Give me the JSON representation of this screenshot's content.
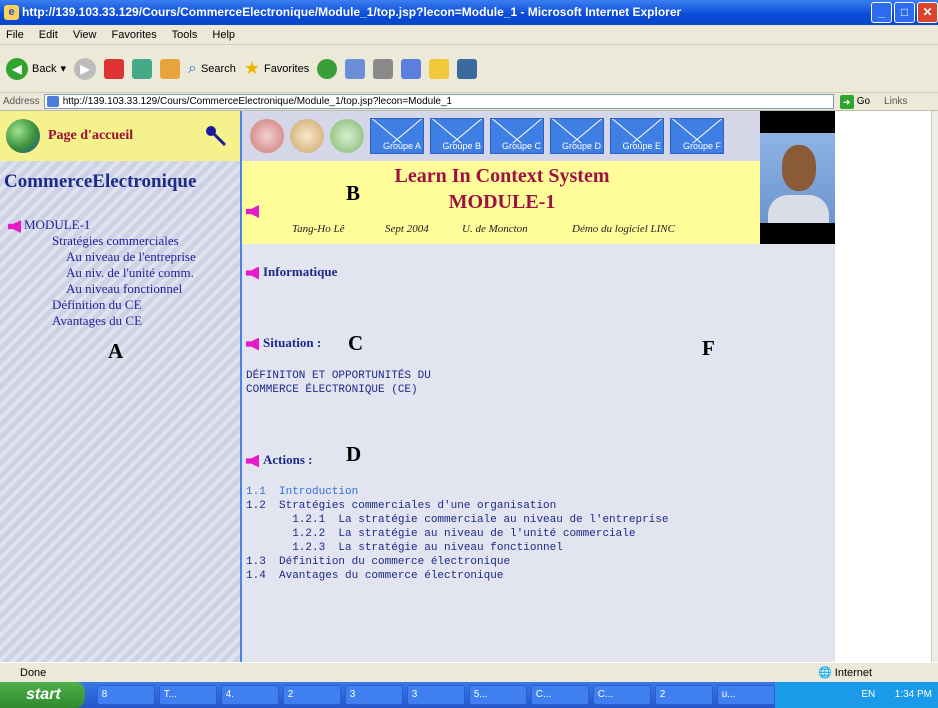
{
  "window": {
    "title": "http://139.103.33.129/Cours/CommerceElectronique/Module_1/top.jsp?lecon=Module_1 - Microsoft Internet Explorer"
  },
  "menu": [
    "File",
    "Edit",
    "View",
    "Favorites",
    "Tools",
    "Help"
  ],
  "toolbar": {
    "back": "Back",
    "search": "Search",
    "favorites": "Favorites"
  },
  "address": {
    "label": "Address",
    "url": "http://139.103.33.129/Cours/CommerceElectronique/Module_1/top.jsp?lecon=Module_1",
    "go": "Go",
    "links": "Links"
  },
  "left": {
    "home": "Page d'accueil",
    "title": "CommerceElectronique",
    "letter": "A",
    "nav": [
      "MODULE-1",
      "Stratégies commerciales",
      "Au niveau de l'entreprise",
      "Au niv. de l'unité comm.",
      "Au niveau fonctionnel",
      "Définition du CE",
      "Avantages du CE"
    ]
  },
  "groups": [
    "Groupe A",
    "Groupe B",
    "Groupe C",
    "Groupe D",
    "Groupe E",
    "Groupe F"
  ],
  "header": {
    "line1": "Learn In Context System",
    "line2": "MODULE-1",
    "letter": "B",
    "author": "Tang-Ho Lê",
    "date": "Sept 2004",
    "univ": "U. de Moncton",
    "demo": "Démo du logiciel LINC"
  },
  "content": {
    "informatique": "Informatique",
    "situation": "Situation :",
    "letterC": "C",
    "letterF": "F",
    "situation_text": "DÉFINITON ET OPPORTUNITÉS DU\nCOMMERCE ÉLECTRONIQUE (CE)",
    "actions": "Actions :",
    "letterD": "D",
    "items": [
      "1.1  Introduction",
      "1.2  Stratégies commerciales d'une organisation",
      "       1.2.1  La stratégie commerciale au niveau de l'entreprise",
      "       1.2.2  La stratégie au niveau de l'unité commerciale",
      "       1.2.3  La stratégie au niveau fonctionnel",
      "1.3  Définition du commerce électronique",
      "1.4  Avantages du commerce électronique"
    ]
  },
  "status": {
    "text": "Done",
    "zone": "Internet"
  },
  "taskbar": {
    "start": "start",
    "tasks": [
      "8",
      "T...",
      "4.",
      "2",
      "3",
      "3",
      "5...",
      "C...",
      "C...",
      "2",
      "u..."
    ],
    "lang": "EN",
    "time": "1:34 PM"
  }
}
